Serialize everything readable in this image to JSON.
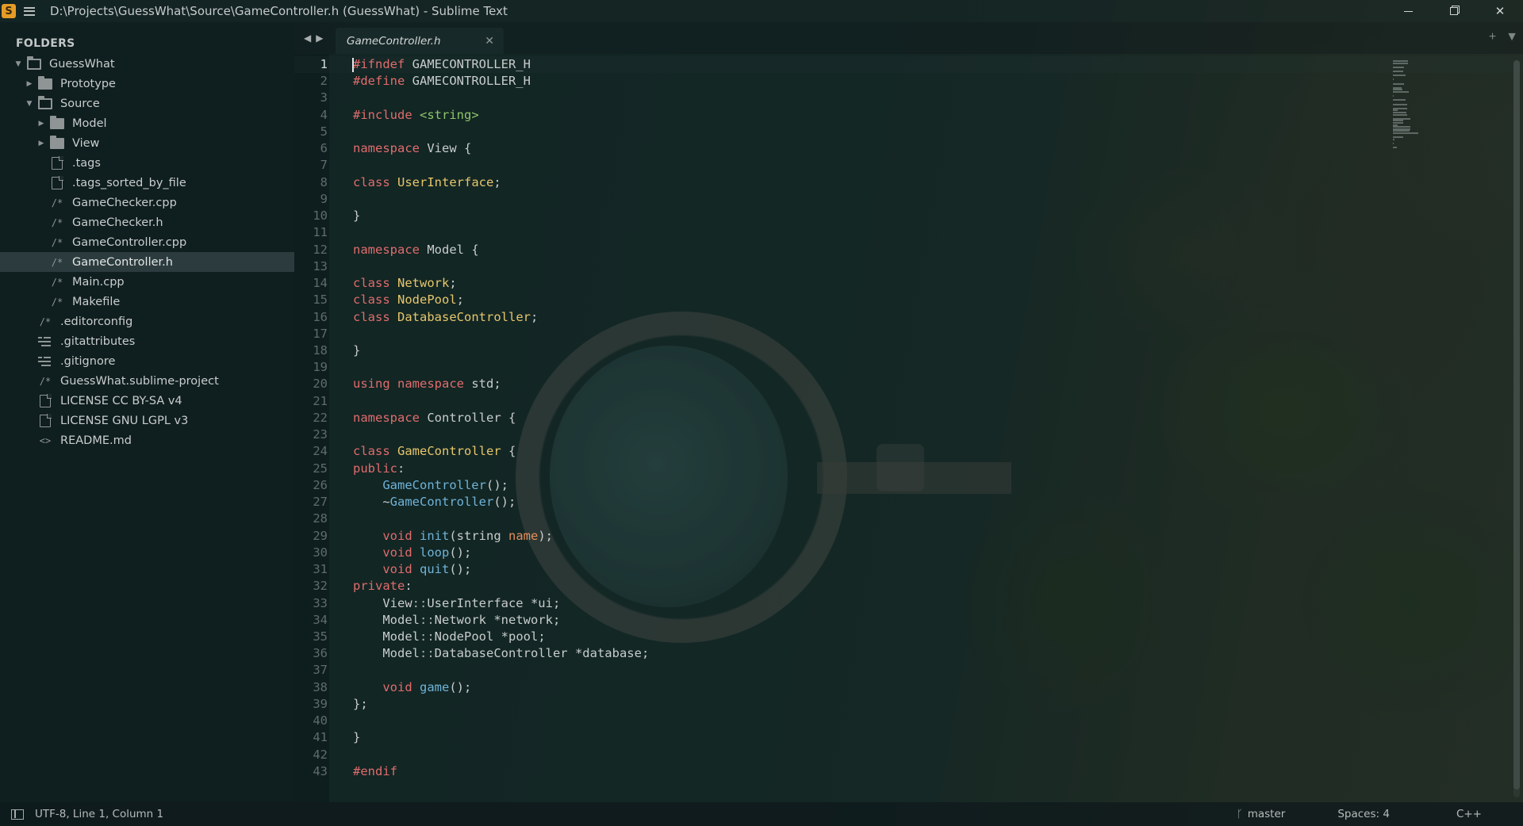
{
  "window": {
    "title": "D:\\Projects\\GuessWhat\\Source\\GameController.h (GuessWhat) - Sublime Text",
    "app_logo": "S",
    "controls": {
      "minimize": "minimize-icon",
      "maximize": "maximize-icon",
      "close": "✕"
    }
  },
  "sidebar": {
    "heading": "FOLDERS",
    "tree": [
      {
        "label": "GuessWhat",
        "level": 0,
        "kind": "folder-open",
        "expanded": true
      },
      {
        "label": "Prototype",
        "level": 1,
        "kind": "folder",
        "expanded": false
      },
      {
        "label": "Source",
        "level": 1,
        "kind": "folder-open",
        "expanded": true
      },
      {
        "label": "Model",
        "level": 2,
        "kind": "folder",
        "expanded": false
      },
      {
        "label": "View",
        "level": 2,
        "kind": "folder",
        "expanded": false
      },
      {
        "label": ".tags",
        "level": 2,
        "kind": "file"
      },
      {
        "label": ".tags_sorted_by_file",
        "level": 2,
        "kind": "file"
      },
      {
        "label": "GameChecker.cpp",
        "level": 2,
        "kind": "comment"
      },
      {
        "label": "GameChecker.h",
        "level": 2,
        "kind": "comment"
      },
      {
        "label": "GameController.cpp",
        "level": 2,
        "kind": "comment"
      },
      {
        "label": "GameController.h",
        "level": 2,
        "kind": "comment",
        "selected": true
      },
      {
        "label": "Main.cpp",
        "level": 2,
        "kind": "comment"
      },
      {
        "label": "Makefile",
        "level": 2,
        "kind": "comment"
      },
      {
        "label": ".editorconfig",
        "level": 1,
        "kind": "comment"
      },
      {
        "label": ".gitattributes",
        "level": 1,
        "kind": "lines"
      },
      {
        "label": ".gitignore",
        "level": 1,
        "kind": "lines"
      },
      {
        "label": "GuessWhat.sublime-project",
        "level": 1,
        "kind": "comment"
      },
      {
        "label": "LICENSE CC BY-SA v4",
        "level": 1,
        "kind": "file"
      },
      {
        "label": "LICENSE GNU LGPL v3",
        "level": 1,
        "kind": "file"
      },
      {
        "label": "README.md",
        "level": 1,
        "kind": "markup"
      }
    ]
  },
  "tabs": {
    "back": "◀",
    "forward": "▶",
    "active": {
      "label": "GameController.h",
      "close": "✕"
    },
    "new_tab": "+",
    "tab_menu": "▼"
  },
  "editor": {
    "current_line": 1,
    "lines": [
      [
        [
          "t-pp",
          "#ifndef"
        ],
        [
          "t-pl",
          " GAMECONTROLLER_H"
        ]
      ],
      [
        [
          "t-pp",
          "#define"
        ],
        [
          "t-pl",
          " GAMECONTROLLER_H"
        ]
      ],
      [],
      [
        [
          "t-pp",
          "#include"
        ],
        [
          "t-pl",
          " "
        ],
        [
          "t-str",
          "<string>"
        ]
      ],
      [],
      [
        [
          "t-kw",
          "namespace"
        ],
        [
          "t-pl",
          " View {"
        ]
      ],
      [],
      [
        [
          "t-kw",
          "class"
        ],
        [
          "t-pl",
          " "
        ],
        [
          "t-ty",
          "UserInterface"
        ],
        [
          "t-pl",
          ";"
        ]
      ],
      [],
      [
        [
          "t-pl",
          "}"
        ]
      ],
      [],
      [
        [
          "t-kw",
          "namespace"
        ],
        [
          "t-pl",
          " Model {"
        ]
      ],
      [],
      [
        [
          "t-kw",
          "class"
        ],
        [
          "t-pl",
          " "
        ],
        [
          "t-ty",
          "Network"
        ],
        [
          "t-pl",
          ";"
        ]
      ],
      [
        [
          "t-kw",
          "class"
        ],
        [
          "t-pl",
          " "
        ],
        [
          "t-ty",
          "NodePool"
        ],
        [
          "t-pl",
          ";"
        ]
      ],
      [
        [
          "t-kw",
          "class"
        ],
        [
          "t-pl",
          " "
        ],
        [
          "t-ty",
          "DatabaseController"
        ],
        [
          "t-pl",
          ";"
        ]
      ],
      [],
      [
        [
          "t-pl",
          "}"
        ]
      ],
      [],
      [
        [
          "t-kw",
          "using"
        ],
        [
          "t-pl",
          " "
        ],
        [
          "t-kw",
          "namespace"
        ],
        [
          "t-pl",
          " std;"
        ]
      ],
      [],
      [
        [
          "t-kw",
          "namespace"
        ],
        [
          "t-pl",
          " Controller {"
        ]
      ],
      [],
      [
        [
          "t-kw",
          "class"
        ],
        [
          "t-pl",
          " "
        ],
        [
          "t-ty",
          "GameController"
        ],
        [
          "t-pl",
          " {"
        ]
      ],
      [
        [
          "t-kw",
          "public"
        ],
        [
          "t-pl",
          ":"
        ]
      ],
      [
        [
          "t-pl",
          "    "
        ],
        [
          "t-fn",
          "GameController"
        ],
        [
          "t-pl",
          "();"
        ]
      ],
      [
        [
          "t-pl",
          "    ~"
        ],
        [
          "t-fn",
          "GameController"
        ],
        [
          "t-pl",
          "();"
        ]
      ],
      [],
      [
        [
          "t-pl",
          "    "
        ],
        [
          "t-kw",
          "void"
        ],
        [
          "t-pl",
          " "
        ],
        [
          "t-fn",
          "init"
        ],
        [
          "t-pl",
          "(string "
        ],
        [
          "t-par",
          "name"
        ],
        [
          "t-pl",
          ");"
        ]
      ],
      [
        [
          "t-pl",
          "    "
        ],
        [
          "t-kw",
          "void"
        ],
        [
          "t-pl",
          " "
        ],
        [
          "t-fn",
          "loop"
        ],
        [
          "t-pl",
          "();"
        ]
      ],
      [
        [
          "t-pl",
          "    "
        ],
        [
          "t-kw",
          "void"
        ],
        [
          "t-pl",
          " "
        ],
        [
          "t-fn",
          "quit"
        ],
        [
          "t-pl",
          "();"
        ]
      ],
      [
        [
          "t-kw",
          "private"
        ],
        [
          "t-pl",
          ":"
        ]
      ],
      [
        [
          "t-pl",
          "    View"
        ],
        [
          "t-gy",
          "::"
        ],
        [
          "t-pl",
          "UserInterface *ui;"
        ]
      ],
      [
        [
          "t-pl",
          "    Model"
        ],
        [
          "t-gy",
          "::"
        ],
        [
          "t-pl",
          "Network *network;"
        ]
      ],
      [
        [
          "t-pl",
          "    Model"
        ],
        [
          "t-gy",
          "::"
        ],
        [
          "t-pl",
          "NodePool *pool;"
        ]
      ],
      [
        [
          "t-pl",
          "    Model"
        ],
        [
          "t-gy",
          "::"
        ],
        [
          "t-pl",
          "DatabaseController *database;"
        ]
      ],
      [],
      [
        [
          "t-pl",
          "    "
        ],
        [
          "t-kw",
          "void"
        ],
        [
          "t-pl",
          " "
        ],
        [
          "t-fn",
          "game"
        ],
        [
          "t-pl",
          "();"
        ]
      ],
      [
        [
          "t-pl",
          "};"
        ]
      ],
      [],
      [
        [
          "t-pl",
          "}"
        ]
      ],
      [],
      [
        [
          "t-pp",
          "#endif"
        ]
      ]
    ]
  },
  "status": {
    "position": "UTF-8, Line 1, Column 1",
    "branch": "master",
    "indentation": "Spaces: 4",
    "syntax": "C++"
  },
  "colors": {
    "keyword": "#e06c6c",
    "type": "#e7c66b",
    "function": "#6fb3d8",
    "string": "#8fc46a",
    "accent_logo": "#e59c27"
  }
}
